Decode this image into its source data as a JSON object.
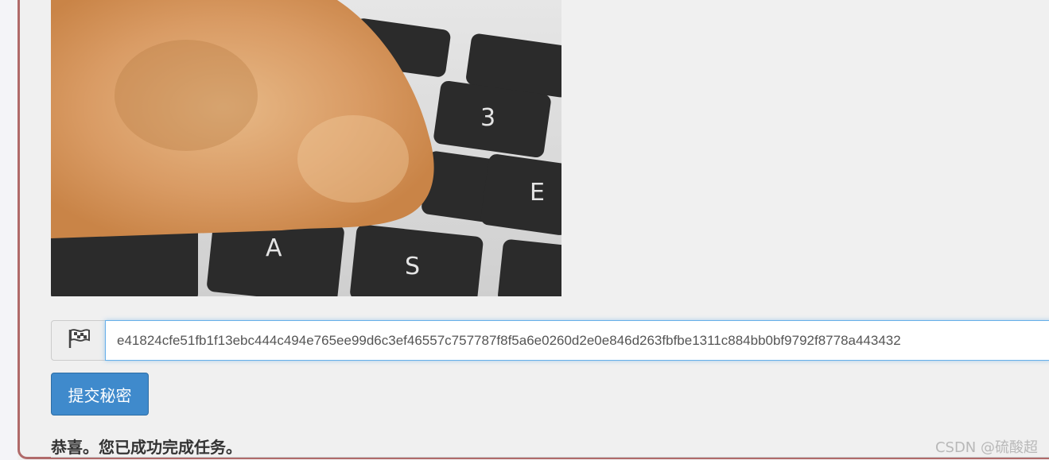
{
  "form": {
    "flag_icon": "checkered-flag-icon",
    "secret_value": "e41824cfe51fb1f13ebc444c494e765ee99d6c3ef46557c757787f8f5a6e0260d2e0e846d263fbfbe1311c884bb0bf9792f8778a443432",
    "submit_label": "提交秘密"
  },
  "result": {
    "message": "恭喜。您已成功完成任务。"
  },
  "watermark": "CSDN @硫酸超",
  "colors": {
    "accent": "#3f8acc",
    "panel_border": "#b06a6a",
    "focus_border": "#66afe9"
  }
}
